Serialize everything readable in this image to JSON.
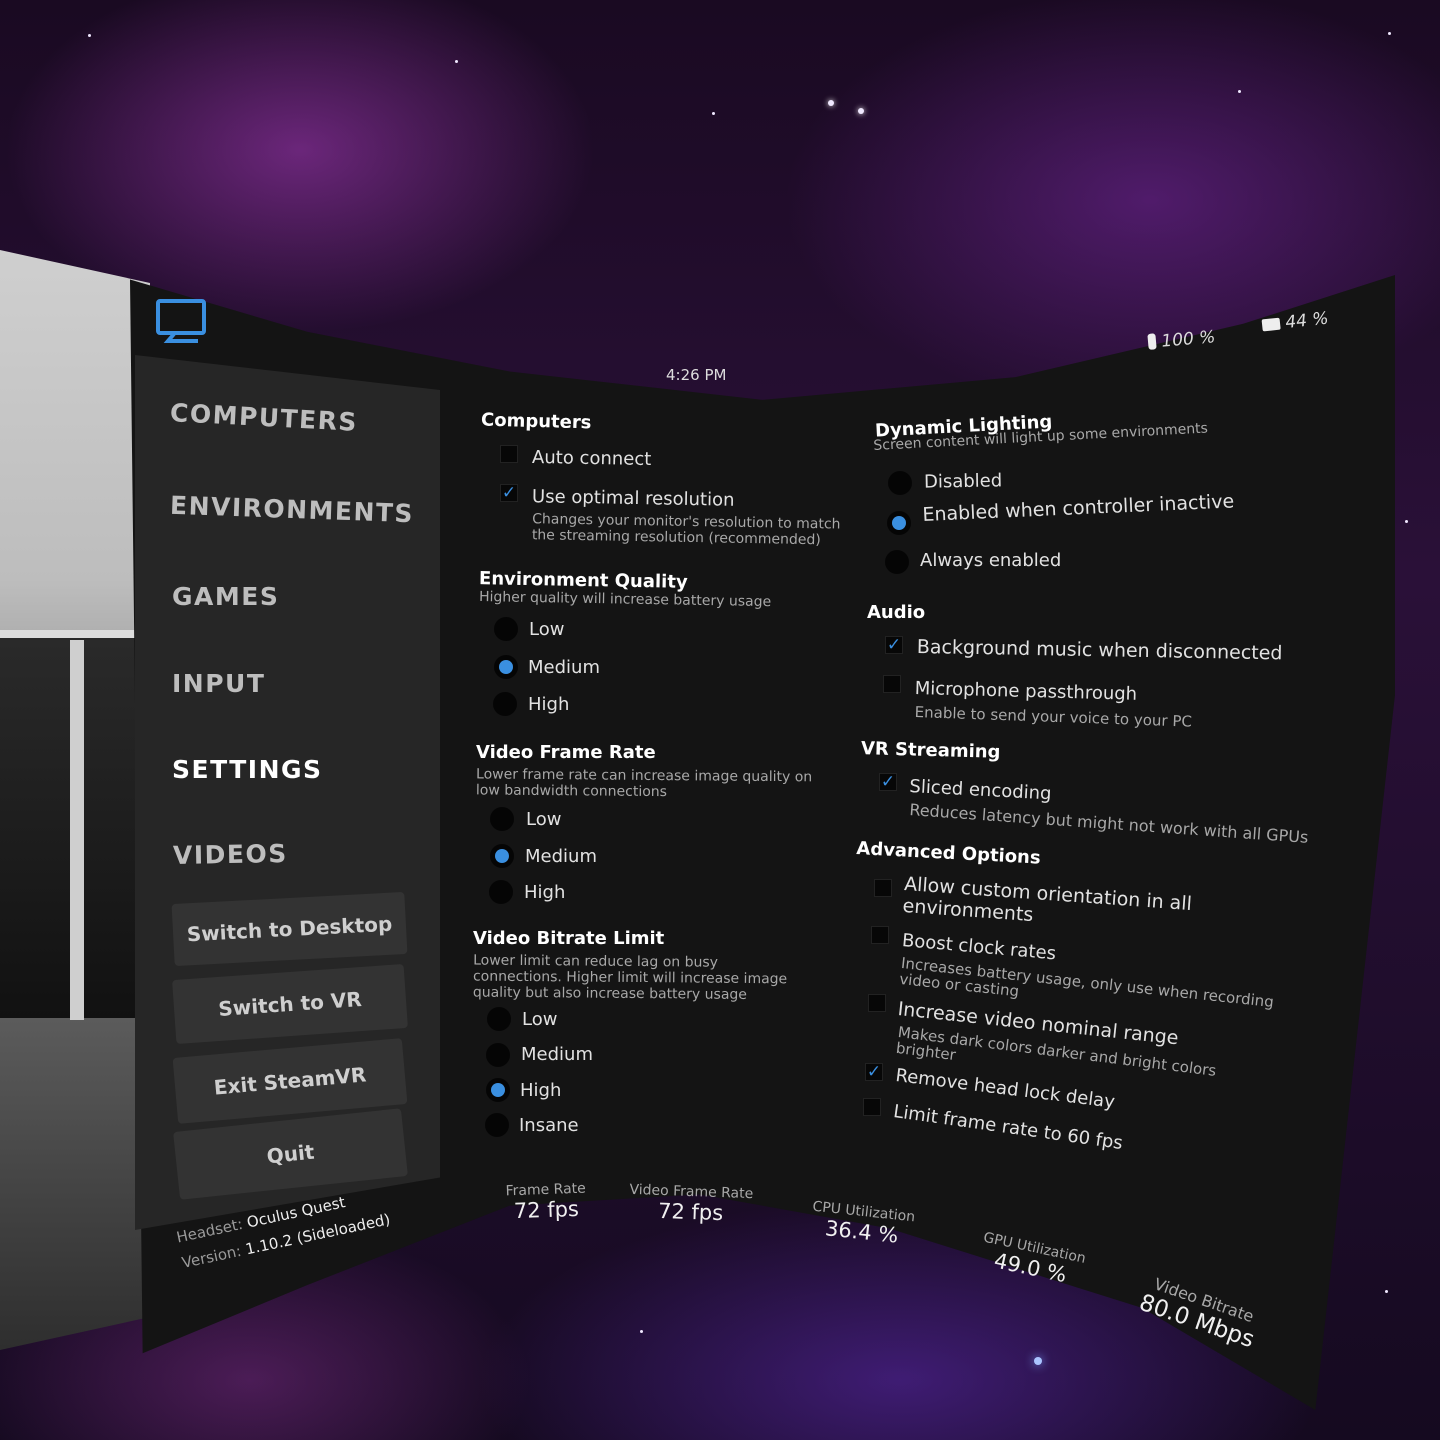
{
  "header": {
    "time": "4:26 PM",
    "controller_battery": "100 %",
    "headset_battery": "44 %"
  },
  "sidebar": {
    "nav": [
      "COMPUTERS",
      "ENVIRONMENTS",
      "GAMES",
      "INPUT",
      "SETTINGS",
      "VIDEOS"
    ],
    "active": "SETTINGS",
    "buttons": [
      "Switch to Desktop",
      "Switch to VR",
      "Exit SteamVR",
      "Quit"
    ]
  },
  "settings": {
    "computers": {
      "title": "Computers",
      "auto_connect": {
        "label": "Auto connect",
        "checked": false
      },
      "optimal_resolution": {
        "label": "Use optimal resolution",
        "checked": true,
        "desc": "Changes your monitor's resolution to match the streaming resolution (recommended)"
      }
    },
    "environment_quality": {
      "title": "Environment Quality",
      "desc": "Higher quality will increase battery usage",
      "options": [
        "Low",
        "Medium",
        "High"
      ],
      "selected": "Medium"
    },
    "video_frame_rate": {
      "title": "Video Frame Rate",
      "desc": "Lower frame rate can increase image quality on low bandwidth connections",
      "options": [
        "Low",
        "Medium",
        "High"
      ],
      "selected": "Medium"
    },
    "video_bitrate_limit": {
      "title": "Video Bitrate Limit",
      "desc": "Lower limit can reduce lag on busy connections. Higher limit will increase image quality but also increase battery usage",
      "options": [
        "Low",
        "Medium",
        "High",
        "Insane"
      ],
      "selected": "High"
    },
    "dynamic_lighting": {
      "title": "Dynamic Lighting",
      "desc": "Screen content will light up some environments",
      "options": [
        "Disabled",
        "Enabled when controller inactive",
        "Always enabled"
      ],
      "selected": "Enabled when controller inactive"
    },
    "audio": {
      "title": "Audio",
      "background_music": {
        "label": "Background music when disconnected",
        "checked": true
      },
      "mic_passthrough": {
        "label": "Microphone passthrough",
        "checked": false,
        "desc": "Enable to send your voice to your PC"
      }
    },
    "vr_streaming": {
      "title": "VR Streaming",
      "sliced_encoding": {
        "label": "Sliced encoding",
        "checked": true,
        "desc": "Reduces latency but might not work with all GPUs"
      }
    },
    "advanced": {
      "title": "Advanced Options",
      "custom_orientation": {
        "label": "Allow custom orientation in all environments",
        "checked": false
      },
      "boost_clock": {
        "label": "Boost clock rates",
        "checked": false,
        "desc": "Increases battery usage, only use when recording video or casting"
      },
      "video_range": {
        "label": "Increase video nominal range",
        "checked": false,
        "desc": "Makes dark colors darker and bright colors brighter"
      },
      "head_lock": {
        "label": "Remove head lock delay",
        "checked": true
      },
      "limit_60": {
        "label": "Limit frame rate to 60 fps",
        "checked": false
      }
    }
  },
  "footer": {
    "headset_label": "Headset:",
    "headset_value": "Oculus Quest",
    "version_label": "Version:",
    "version_value": "1.10.2 (Sideloaded)",
    "stats": [
      {
        "label": "Frame Rate",
        "value": "72 fps"
      },
      {
        "label": "Video Frame Rate",
        "value": "72 fps"
      },
      {
        "label": "CPU Utilization",
        "value": "36.4 %"
      },
      {
        "label": "GPU Utilization",
        "value": "49.0 %"
      },
      {
        "label": "Video Bitrate",
        "value": "80.0 Mbps"
      }
    ]
  },
  "colors": {
    "accent": "#3a8fe0",
    "panel": "#141414",
    "sidebar": "#262626"
  }
}
